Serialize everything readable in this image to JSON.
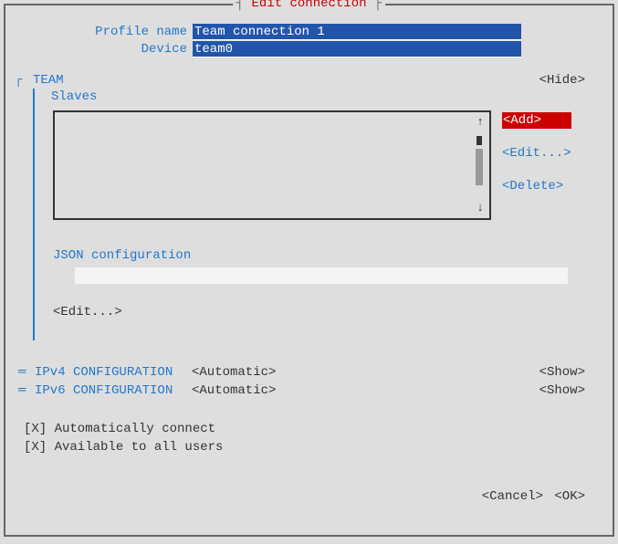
{
  "dialog": {
    "title": "Edit connection"
  },
  "fields": {
    "profile_label": "Profile name",
    "profile_value": "Team connection 1",
    "device_label": "Device",
    "device_value": "team0"
  },
  "team": {
    "section_label": "TEAM",
    "hide_label": "<Hide>",
    "slaves_label": "Slaves",
    "actions": {
      "add": "<Add>",
      "edit": "<Edit...>",
      "delete": "<Delete>"
    },
    "json_label": "JSON configuration",
    "json_value": "",
    "edit_below": "<Edit...>"
  },
  "ipv4": {
    "label": "IPv4 CONFIGURATION",
    "value": "<Automatic>",
    "show": "<Show>"
  },
  "ipv6": {
    "label": "IPv6 CONFIGURATION",
    "value": "<Automatic>",
    "show": "<Show>"
  },
  "checks": {
    "auto_connect": "[X] Automatically connect",
    "all_users": "[X] Available to all users"
  },
  "buttons": {
    "cancel": "<Cancel>",
    "ok": "<OK>"
  }
}
